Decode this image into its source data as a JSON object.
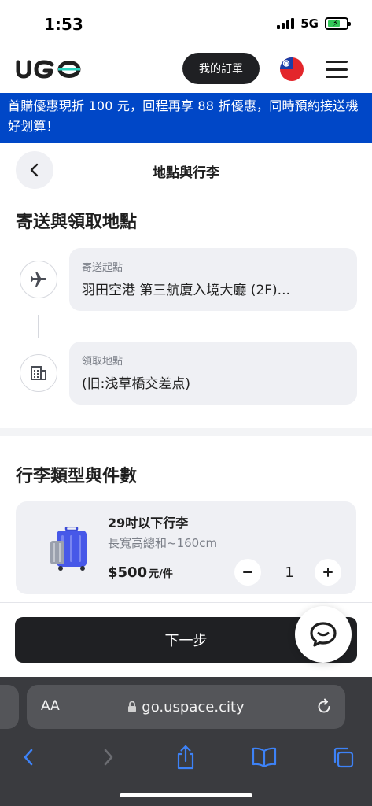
{
  "status": {
    "time": "1:53",
    "network": "5G"
  },
  "header": {
    "orders_label": "我的訂單"
  },
  "promo": {
    "text": "首購優惠現折 100 元，回程再享 88 折優惠，同時預約接送機好划算！"
  },
  "page": {
    "title": "地點與行李"
  },
  "locations": {
    "section_title": "寄送與領取地點",
    "origin": {
      "label": "寄送起點",
      "value": "羽田空港 第三航廈入境大廳 (2F)..."
    },
    "destination": {
      "label": "領取地點",
      "value": "(旧:浅草橋交差点)"
    }
  },
  "luggage": {
    "section_title": "行李類型與件數",
    "items": [
      {
        "name": "29吋以下行李",
        "dimensions": "長寬高總和~160cm",
        "price": "$500",
        "unit": "元/件",
        "quantity": "1"
      }
    ]
  },
  "actions": {
    "next_label": "下一步"
  },
  "browser": {
    "aa_label": "AA",
    "url": "go.uspace.city"
  },
  "colors": {
    "brand_blue": "#0047c7",
    "dark_button": "#1f2023",
    "card_bg": "#eff0f4"
  },
  "icons": [
    "airplane-icon",
    "building-icon",
    "chevron-left-icon",
    "chat-icon",
    "hamburger-menu-icon",
    "taiwan-flag-icon"
  ]
}
